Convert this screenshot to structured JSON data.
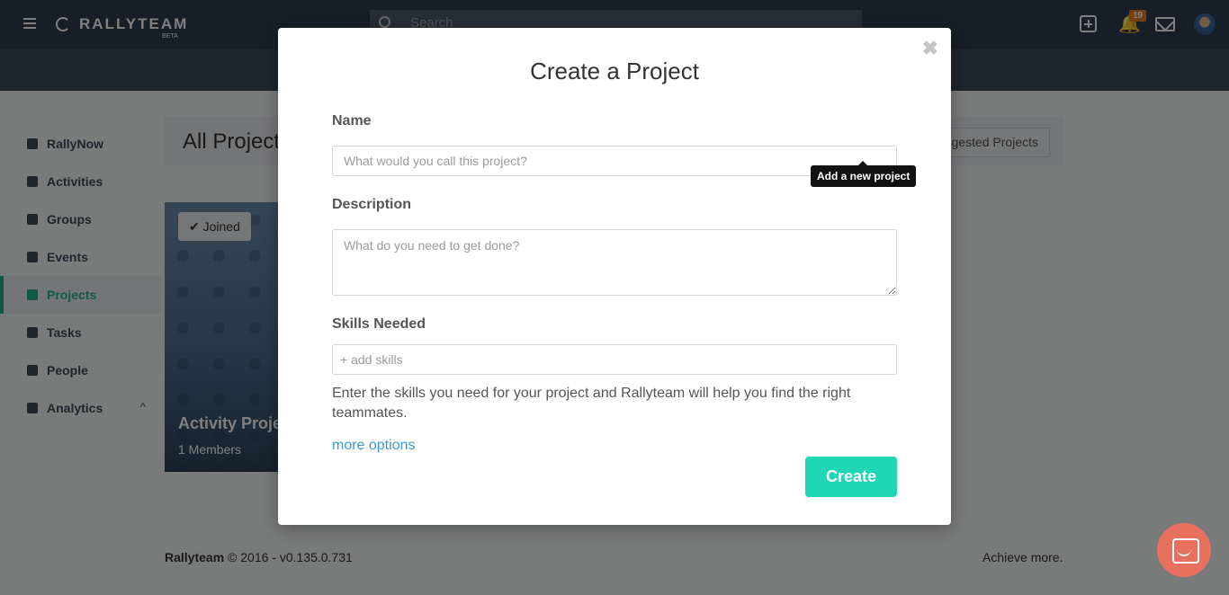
{
  "app": {
    "name": "RALLYTEAM",
    "beta_label": "BETA"
  },
  "topbar": {
    "search_placeholder": "Search",
    "notification_count": "19",
    "icons": [
      "menu-icon",
      "add-icon",
      "bell-icon",
      "mail-icon",
      "avatar"
    ]
  },
  "sidebar": {
    "items": [
      {
        "label": "RallyNow",
        "icon": "rocket-icon"
      },
      {
        "label": "Activities",
        "icon": "feed-icon"
      },
      {
        "label": "Groups",
        "icon": "users-icon"
      },
      {
        "label": "Events",
        "icon": "calendar-icon"
      },
      {
        "label": "Projects",
        "icon": "list-icon",
        "active": true
      },
      {
        "label": "Tasks",
        "icon": "checkbox-icon"
      },
      {
        "label": "People",
        "icon": "user-icon"
      },
      {
        "label": "Analytics",
        "icon": "chart-icon"
      }
    ]
  },
  "page": {
    "title": "All Project",
    "suggested_button": "gested Projects"
  },
  "card": {
    "joined_label": "Joined",
    "title": "Activity Proje",
    "members": "1 Members"
  },
  "footer": {
    "brand": "Rallyteam",
    "copyright": " © 2016 - v0.135.0.731",
    "tagline": "Achieve more."
  },
  "modal": {
    "title": "Create a Project",
    "close_symbol": "✖",
    "name_label": "Name",
    "name_placeholder": "What would you call this project?",
    "tooltip": "Add a new project",
    "description_label": "Description",
    "description_placeholder": "What do you need to get done?",
    "skills_label": "Skills Needed",
    "skills_placeholder": "+ add skills",
    "skills_help": "Enter the skills you need for your project and Rallyteam will help you find the right teammates.",
    "more_options": "more options",
    "create_button": "Create"
  },
  "colors": {
    "topbar": "#2d3e50",
    "accent": "#1eb58f",
    "create_button": "#1fd6b5",
    "link": "#3a9ad9",
    "badge": "#e67e22",
    "chat": "#e8705f"
  }
}
